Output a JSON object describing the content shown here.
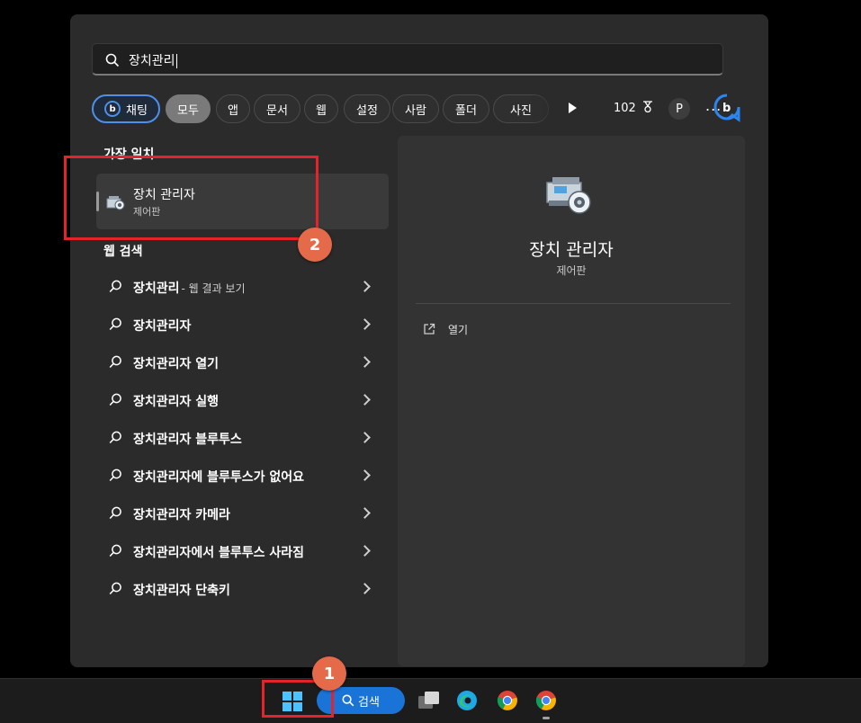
{
  "search": {
    "query": "장치관리"
  },
  "filters": {
    "chat": "채팅",
    "items": [
      "모두",
      "앱",
      "문서",
      "웹",
      "설정",
      "사람",
      "폴더",
      "사진"
    ],
    "points": "102",
    "avatar_initial": "P",
    "more": "..."
  },
  "best_match": {
    "title": "가장 일치",
    "item": {
      "name": "장치 관리자",
      "subtitle": "제어판"
    }
  },
  "web_search": {
    "title": "웹 검색",
    "items": [
      {
        "label": "장치관리",
        "suffix": "- 웹 결과 보기"
      },
      {
        "label": "장치관리자"
      },
      {
        "label": "장치관리자 열기"
      },
      {
        "label": "장치관리자 실행"
      },
      {
        "label": "장치관리자 블루투스"
      },
      {
        "label": "장치관리자에 블루투스가 없어요"
      },
      {
        "label": "장치관리자 카메라"
      },
      {
        "label": "장치관리자에서 블루투스 사라짐"
      },
      {
        "label": "장치관리자 단축키"
      }
    ]
  },
  "detail": {
    "name": "장치 관리자",
    "subtitle": "제어판",
    "action_open": "열기"
  },
  "taskbar": {
    "search_label": "검색"
  },
  "annotations": {
    "badge1": "1",
    "badge2": "2"
  },
  "colors": {
    "accent": "#1a73d6",
    "highlight": "#e5232b",
    "badge": "#e46a4a"
  }
}
